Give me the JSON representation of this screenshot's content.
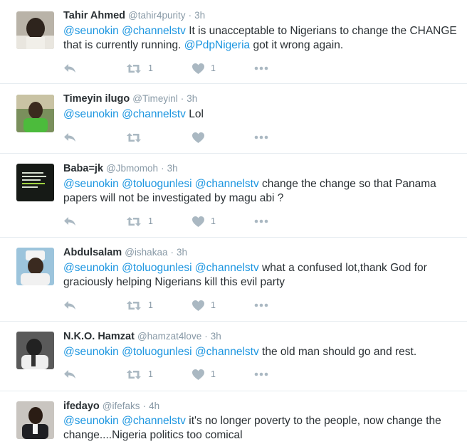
{
  "tweets": [
    {
      "name": "Tahir Ahmed",
      "handle": "@tahir4purity",
      "time": "3h",
      "segments": [
        {
          "text": "@seunokin",
          "mention": true
        },
        {
          "text": " "
        },
        {
          "text": "@channelstv",
          "mention": true
        },
        {
          "text": " It is unacceptable to Nigerians to change the CHANGE that is currently running. "
        },
        {
          "text": "@PdpNigeria",
          "mention": true
        },
        {
          "text": " got it wrong again."
        }
      ],
      "retweets": "1",
      "likes": "1"
    },
    {
      "name": "Timeyin ilugo",
      "handle": "@Timeyinl",
      "time": "3h",
      "segments": [
        {
          "text": "@seunokin",
          "mention": true
        },
        {
          "text": " "
        },
        {
          "text": "@channelstv",
          "mention": true
        },
        {
          "text": " Lol"
        }
      ],
      "retweets": "",
      "likes": ""
    },
    {
      "name": "Baba=jk",
      "handle": "@Jbmomoh",
      "time": "3h",
      "segments": [
        {
          "text": "@seunokin",
          "mention": true
        },
        {
          "text": " "
        },
        {
          "text": "@toluogunlesi",
          "mention": true
        },
        {
          "text": " "
        },
        {
          "text": "@channelstv",
          "mention": true
        },
        {
          "text": " change the change so that Panama papers will not be investigated by magu abi ?"
        }
      ],
      "retweets": "1",
      "likes": "1"
    },
    {
      "name": "Abdulsalam",
      "handle": "@ishakaa",
      "time": "3h",
      "segments": [
        {
          "text": "@seunokin",
          "mention": true
        },
        {
          "text": " "
        },
        {
          "text": "@toluogunlesi",
          "mention": true
        },
        {
          "text": " "
        },
        {
          "text": "@channelstv",
          "mention": true
        },
        {
          "text": " what a confused lot,thank God for graciously helping Nigerians kill this evil party"
        }
      ],
      "retweets": "1",
      "likes": "1"
    },
    {
      "name": "N.K.O. Hamzat",
      "handle": "@hamzat4love",
      "time": "3h",
      "segments": [
        {
          "text": "@seunokin",
          "mention": true
        },
        {
          "text": " "
        },
        {
          "text": "@toluogunlesi",
          "mention": true
        },
        {
          "text": " "
        },
        {
          "text": "@channelstv",
          "mention": true
        },
        {
          "text": " the old man should go and rest."
        }
      ],
      "retweets": "1",
      "likes": "1"
    },
    {
      "name": "ifedayo",
      "handle": "@ifefaks",
      "time": "4h",
      "segments": [
        {
          "text": "@seunokin",
          "mention": true
        },
        {
          "text": " "
        },
        {
          "text": "@channelstv",
          "mention": true
        },
        {
          "text": " it's no longer poverty to the people, now change the change....Nigeria politics too comical"
        }
      ],
      "retweets": "",
      "likes": ""
    }
  ],
  "colors": {
    "mention": "#1b95e0",
    "name": "#292f33",
    "meta": "#8899a6",
    "icon": "#aab8c2",
    "divider": "#e6ecf0"
  }
}
